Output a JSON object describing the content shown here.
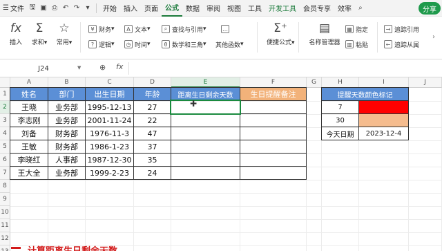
{
  "titlebar": {
    "menu_label": "文件",
    "tabs": [
      "开始",
      "插入",
      "页面",
      "公式",
      "数据",
      "审阅",
      "视图",
      "工具",
      "开发工具",
      "会员专享",
      "效率"
    ],
    "active_tab": "公式",
    "share_label": "分享"
  },
  "ribbon": {
    "insert_func": "插入",
    "autosum": "求和",
    "common": "常用",
    "finance": "财务",
    "logic": "逻辑",
    "text": "文本",
    "time": "时间",
    "lookup": "查找与引用",
    "math": "数学和三角",
    "more_funcs": "其他函数",
    "quick_formula": "便捷公式",
    "name_manager": "名称管理器",
    "specify": "指定",
    "paste": "粘贴",
    "trace_precedents": "追踪引用",
    "trace_dependents": "追踪从属"
  },
  "formula_bar": {
    "name_box": "J24",
    "formula": ""
  },
  "sheet": {
    "columns": [
      "A",
      "B",
      "C",
      "D",
      "E",
      "F",
      "G",
      "H",
      "I",
      "J"
    ],
    "selected_column": "E",
    "rows": [
      "1",
      "2",
      "3",
      "4",
      "5",
      "6",
      "7",
      "8",
      "9",
      "10",
      "11",
      "12",
      "13"
    ],
    "selected_row": "2",
    "main_table": {
      "headers": [
        "姓名",
        "部门",
        "出生日期",
        "年龄",
        "距离生日剩余天数",
        "生日提醒备注"
      ],
      "data": [
        [
          "王晓",
          "业务部",
          "1995-12-13",
          "27",
          "",
          ""
        ],
        [
          "李志刚",
          "业务部",
          "2001-11-24",
          "22",
          "",
          ""
        ],
        [
          "刘备",
          "财务部",
          "1976-11-3",
          "47",
          "",
          ""
        ],
        [
          "王敏",
          "财务部",
          "1986-1-23",
          "37",
          "",
          ""
        ],
        [
          "李晓红",
          "人事部",
          "1987-12-30",
          "35",
          "",
          ""
        ],
        [
          "王大全",
          "业务部",
          "1999-2-23",
          "24",
          "",
          ""
        ]
      ]
    },
    "side_table": {
      "header": "提醒天数颜色标记",
      "rows": [
        {
          "label": "7",
          "value": "",
          "color": "#ff0000"
        },
        {
          "label": "30",
          "value": "",
          "color": "#f5bc8e"
        },
        {
          "label": "今天日期",
          "value": "2023-12-4",
          "color": "#ffffff"
        }
      ]
    },
    "colors": {
      "header_blue": "#5b8fd6",
      "header_orange": "#f2b27a",
      "selection_green": "#1a8a3e"
    }
  },
  "caption": "计算距离生日剩余天数"
}
